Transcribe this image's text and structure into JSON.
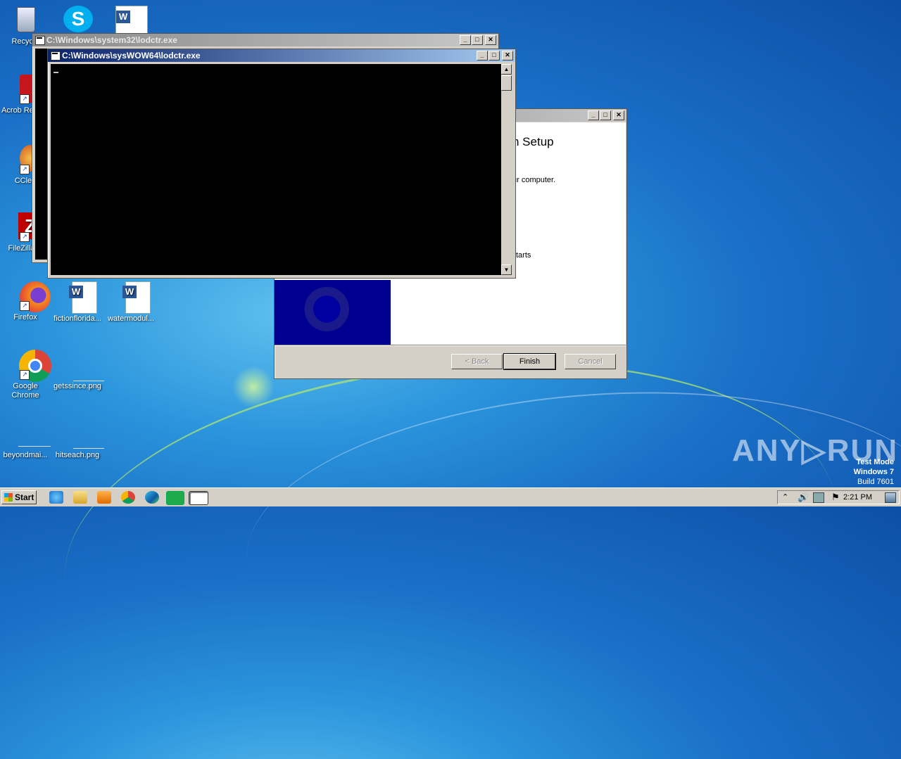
{
  "desktop": {
    "icons": [
      {
        "label": "Recycle",
        "icon": "recycle-bin-icon"
      },
      {
        "label": "Acrob Reader",
        "icon": "acrobat-icon"
      },
      {
        "label": "CClea",
        "icon": "ccleaner-icon"
      },
      {
        "label": "FileZilla C",
        "icon": "filezilla-icon"
      },
      {
        "label": "Firefox",
        "icon": "firefox-icon"
      },
      {
        "label": "Google Chrome",
        "icon": "chrome-icon"
      },
      {
        "label": "beyondmai...",
        "icon": "png-file-icon"
      },
      {
        "label": "fictionflorida...",
        "icon": "word-doc-icon"
      },
      {
        "label": "getssince.png",
        "icon": "png-file-icon"
      },
      {
        "label": "hitseach.png",
        "icon": "png-file-icon"
      },
      {
        "label": "watermodul...",
        "icon": "word-doc-icon"
      }
    ]
  },
  "windows": {
    "back_console": {
      "title": "C:\\Windows\\system32\\lodctr.exe"
    },
    "front_console": {
      "title": "C:\\Windows\\sysWOW64\\lodctr.exe"
    },
    "setup": {
      "heading_fragment": "n Setup",
      "line1_fragment": "ur computer.",
      "line2_fragment": "tarts",
      "back_label": "< Back",
      "finish_label": "Finish",
      "cancel_label": "Cancel"
    }
  },
  "title_buttons": {
    "minimize": "_",
    "maximize": "□",
    "close": "✕"
  },
  "taskbar": {
    "start_label": "Start",
    "clock": "2:21 PM"
  },
  "watermark": {
    "line1": "Test Mode",
    "line2": "Windows 7",
    "line3": "Build 7601",
    "brand": "ANY▷RUN"
  }
}
